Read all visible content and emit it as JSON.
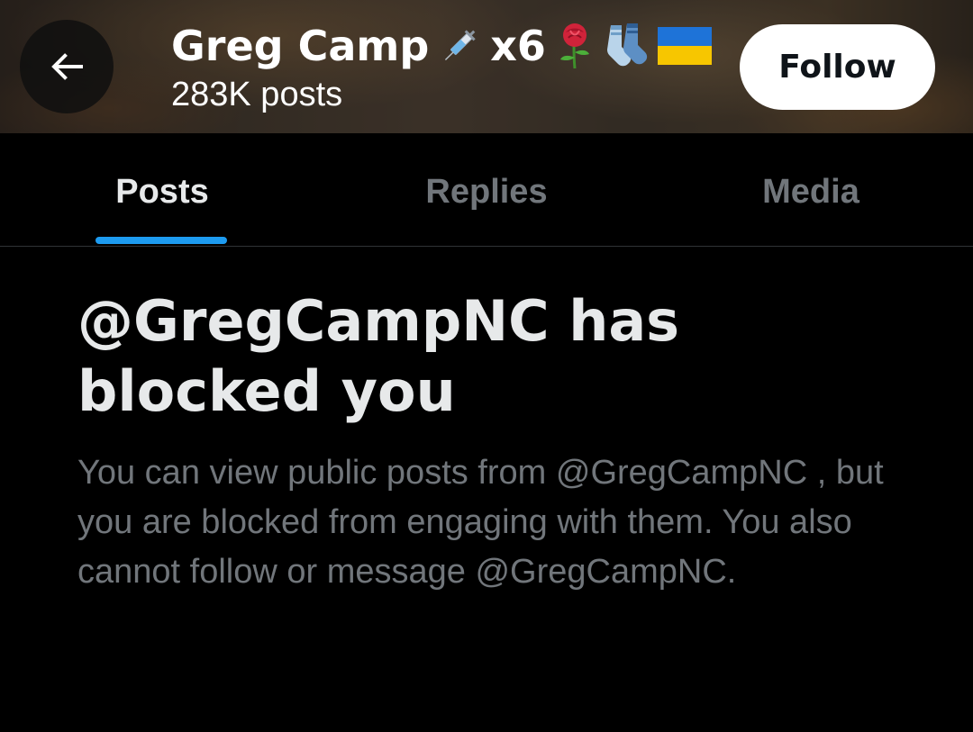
{
  "header": {
    "name": "Greg Camp",
    "name_suffix_text": "x6",
    "emojis": [
      "syringe-emoji",
      "rose-emoji",
      "socks-emoji",
      "ukraine-flag-emoji"
    ],
    "post_count": "283K posts",
    "follow_label": "Follow"
  },
  "tabs": [
    {
      "label": "Posts",
      "active": true
    },
    {
      "label": "Replies",
      "active": false
    },
    {
      "label": "Media",
      "active": false
    }
  ],
  "blocked": {
    "title": "@GregCampNC has blocked you",
    "description": "You can view public posts from @GregCampNC , but you are blocked from engaging with them. You also cannot follow or message @GregCampNC."
  },
  "colors": {
    "accent": "#1d9bf0",
    "text_primary": "#e7e9ea",
    "text_secondary": "#71767b",
    "background": "#000000"
  }
}
